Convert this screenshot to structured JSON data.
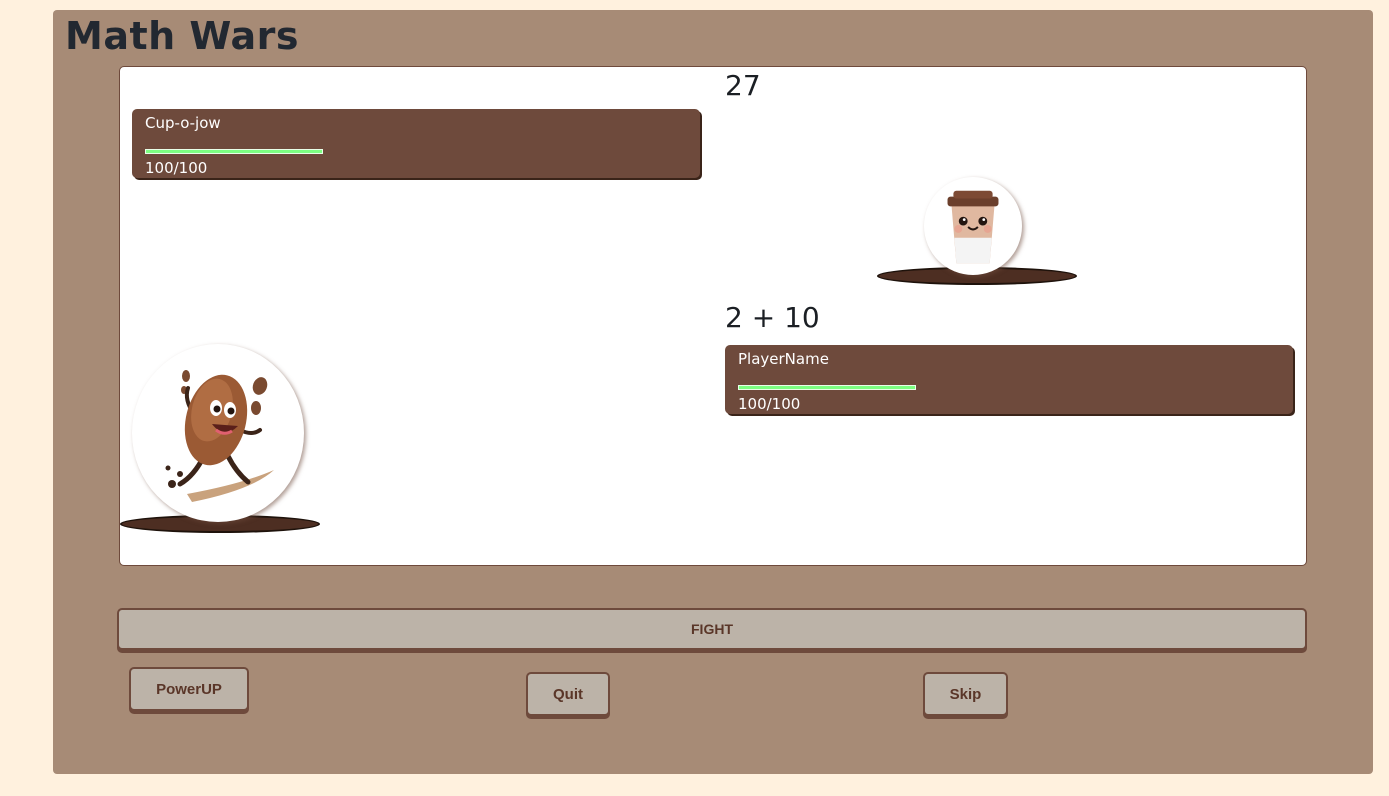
{
  "app": {
    "title": "Math Wars"
  },
  "enemy": {
    "name": "Cup-o-jow",
    "hp_text": "100/100",
    "hp_fraction": 1.0,
    "number": "27",
    "avatar_icon": "coffee-cup-character-icon"
  },
  "player": {
    "name": "PlayerName",
    "hp_text": "100/100",
    "hp_fraction": 1.0,
    "avatar_icon": "coffee-bean-surfer-icon"
  },
  "question": "2 + 10",
  "buttons": {
    "fight": "FIGHT",
    "powerup": "PowerUP",
    "quit": "Quit",
    "skip": "Skip"
  },
  "colors": {
    "page_background": "#fff1de",
    "frame": "#a78b76",
    "stat_box": "#6e4a3c",
    "hp_bar": "#7dff82",
    "button": "#bcb3a8",
    "button_text": "#5a3628"
  }
}
